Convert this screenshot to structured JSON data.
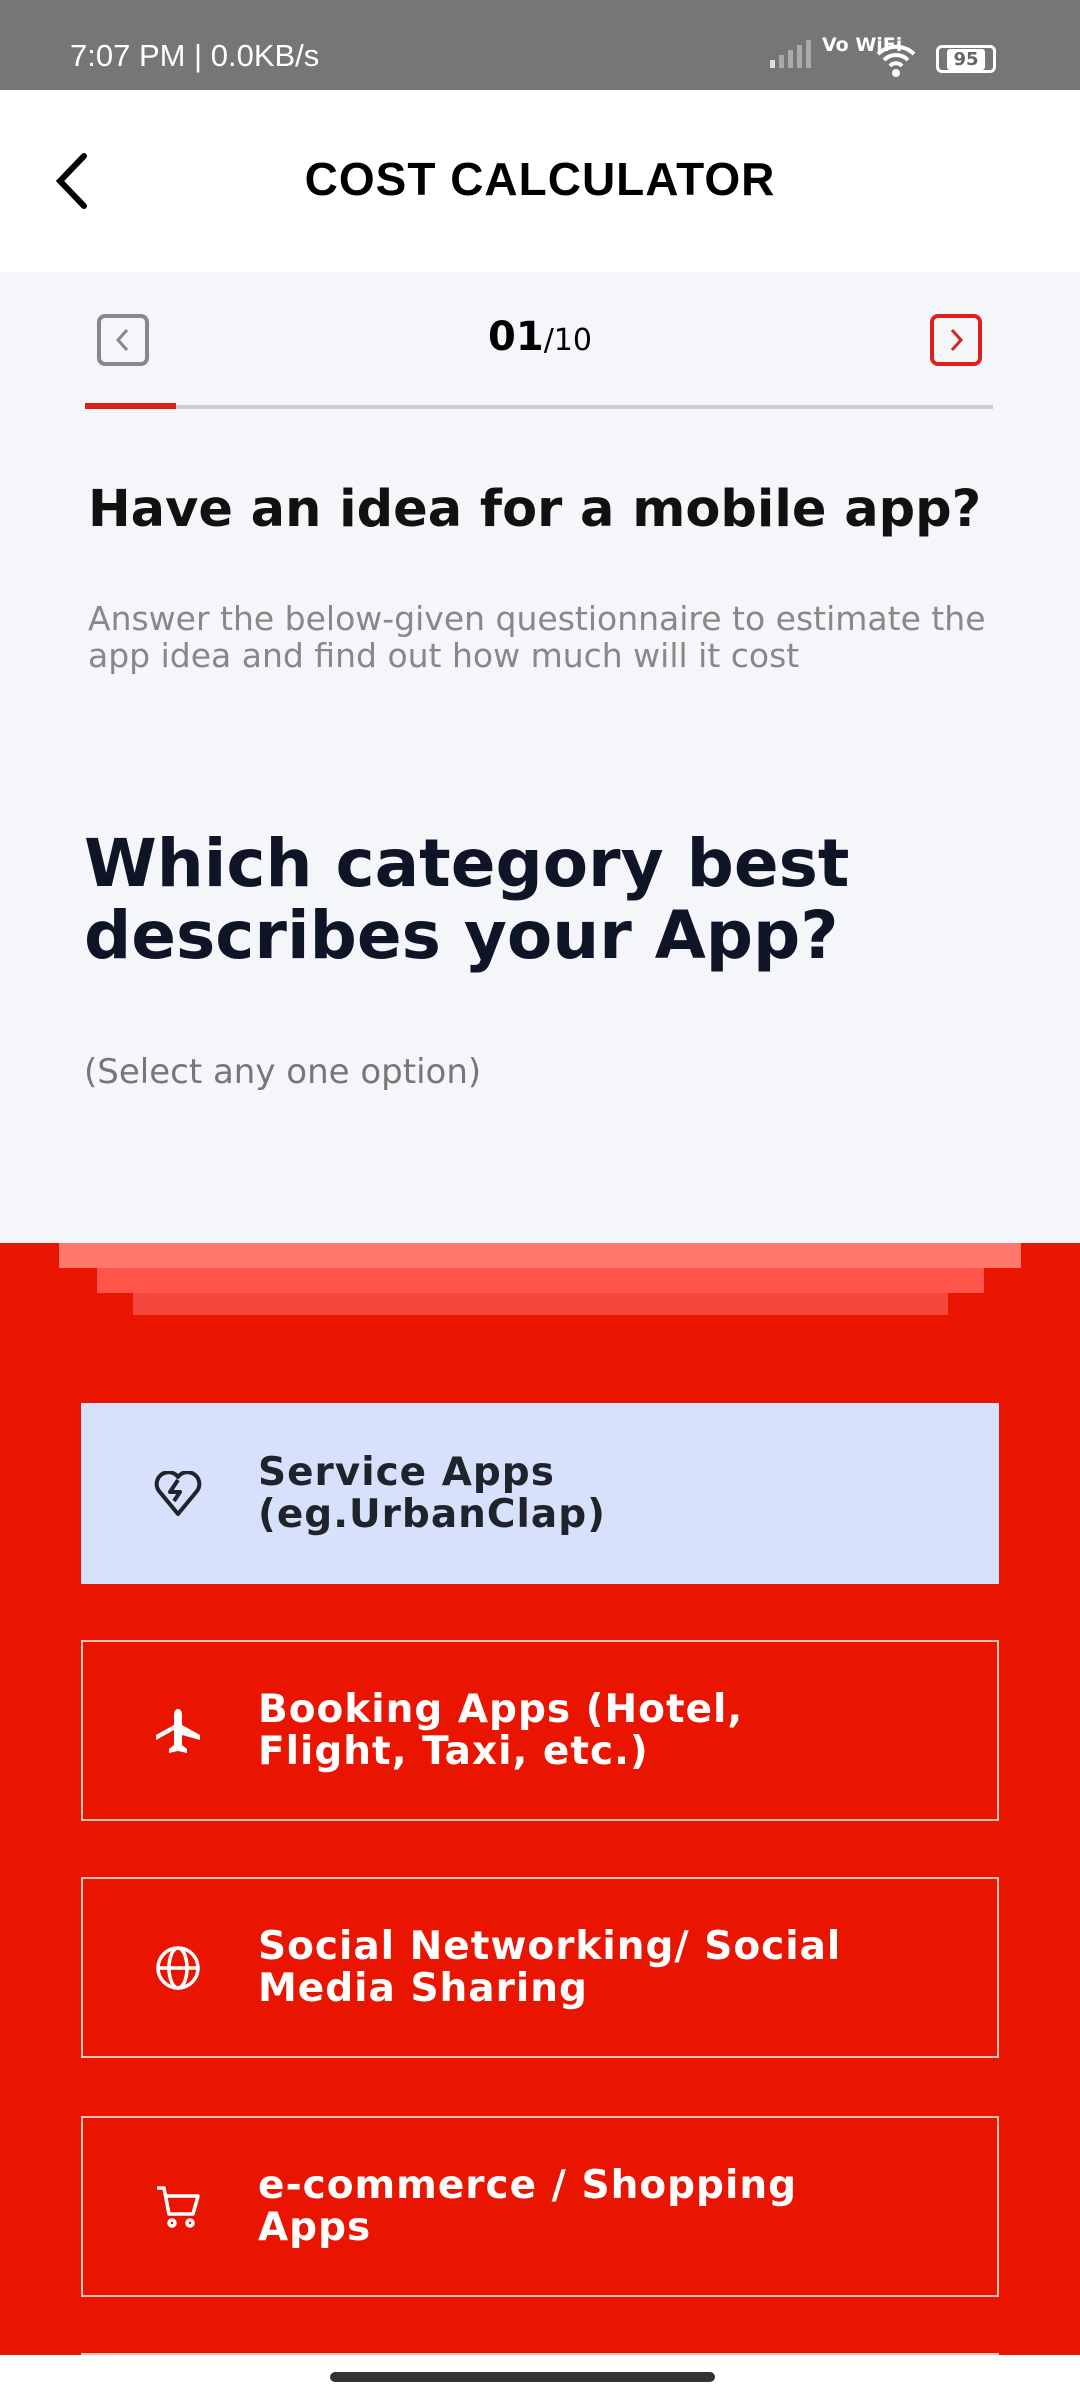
{
  "status_bar": {
    "time": "7:07 PM | 0.0KB/s",
    "network": "Vo WiFi",
    "battery": "95"
  },
  "header": {
    "title": "COST CALCULATOR"
  },
  "pager": {
    "current": "01",
    "total": "/10",
    "progress": 0.1
  },
  "intro": {
    "heading": "Have an idea for a mobile app?",
    "description": "Answer the below-given questionnaire to estimate the app idea and find out how much will it cost"
  },
  "question": {
    "text": "Which category best describes your App?",
    "hint": "(Select any one option)"
  },
  "options": [
    {
      "label": "Service Apps (eg.UrbanClap)",
      "icon": "heart-handshake-icon",
      "selected": true
    },
    {
      "label": "Booking Apps (Hotel, Flight, Taxi, etc.)",
      "icon": "airplane-icon",
      "selected": false
    },
    {
      "label": "Social Networking/ Social Media Sharing",
      "icon": "globe-icon",
      "selected": false
    },
    {
      "label": "e-commerce / Shopping Apps",
      "icon": "cart-icon",
      "selected": false
    }
  ],
  "colors": {
    "accent": "#e91500",
    "selected": "#d8e1fc"
  }
}
